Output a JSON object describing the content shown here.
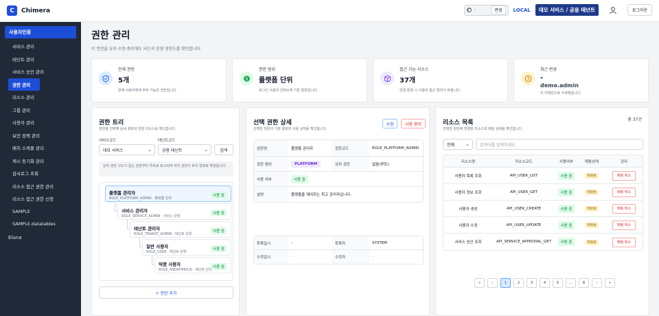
{
  "app": {
    "logo_letter": "C",
    "name": "Chimera"
  },
  "topbar": {
    "lang_value": "-",
    "lang_apply": "변경",
    "env": "LOCAL",
    "tenant": "데모 서비스 / 공용 테넌트",
    "logout": "로그아웃"
  },
  "sidebar": {
    "group": "사용자인증",
    "items": [
      "서비스 관리",
      "테넌트 관리",
      "서비스 승인 관리",
      "권한 관리",
      "리소스 관리",
      "그룹 관리",
      "사용자 관리",
      "보안 정책 관리",
      "배치 스케줄 관리",
      "캐시 동기화 관리",
      "감사로그 조회",
      "리소스 접근 권한 관리",
      "리소스 접근 권한 신청",
      "SAMPLE",
      "SAMPLE-datatables"
    ],
    "active_index": 3,
    "root": "Eluna"
  },
  "page": {
    "title": "권한 관리",
    "subtitle": "이 권한을 유지·수정·중지해도 되는지 운영 영향도를 확인합니다."
  },
  "stats": [
    {
      "label": "전체 권한",
      "value": "5개",
      "desc": "현재 사용자에게 부여 가능한 권한입니다.",
      "icon": "shield-icon",
      "color": "#2563eb",
      "bg": "#dbeafe"
    },
    {
      "label": "권한 범위",
      "value": "플랫폼 단위",
      "desc": "로그인 사용자 선택소에 기준 범위입니다.",
      "icon": "scope-icon",
      "color": "#16a34a",
      "bg": "#dcfce7"
    },
    {
      "label": "접근 가능 리소스",
      "value": "37개",
      "desc": "연결 변경 시 사용자 접근 범위가 바뀝니다.",
      "icon": "cube-icon",
      "color": "#7c3aed",
      "bg": "#ede9fe"
    },
    {
      "label": "최근 변경",
      "value": "-",
      "value2": "demo.admin",
      "desc": "이 이력만으로 수정했습니다.",
      "icon": "clock-icon",
      "color": "#d97706",
      "bg": "#fef3c7"
    }
  ],
  "tree": {
    "title": "권한 트리",
    "subtitle": "권한을 선택해 상세 정보와 연결 리소스를 확인합니다.",
    "service_label": "서비스코드",
    "tenant_label": "테넌트코드",
    "service_value": "데모 서비스",
    "tenant_value": "공용 테넌트",
    "search": "검색",
    "note": "상위 권한 코드가 없는 권한부터 루트로 표시되며 하위 권한이 트리 형태로 확장됩니다.",
    "add": "+ 권한 추가",
    "nodes": [
      {
        "name": "플랫폼 관리자",
        "code": "ROLE_PLATFORM_ADMIN · 플랫폼 단위",
        "status": "사용 중"
      },
      {
        "name": "서비스 관리자",
        "code": "ROLE_SERVICE_ADMIN · 서비스 단위",
        "status": "사용 중"
      },
      {
        "name": "테넌트 관리자",
        "code": "ROLE_TENANT_ADMIN · 테넌트 단위",
        "status": "사용 중"
      },
      {
        "name": "일반 사용자",
        "code": "ROLE_USER · 테넌트 단위",
        "status": "사용 중"
      },
      {
        "name": "익명 사용자",
        "code": "ROLE_ANONYMOUS · 테넌트 단위",
        "status": "사용 중"
      }
    ]
  },
  "detail": {
    "title": "선택 권한 상세",
    "subtitle": "선택한 권한의 기본 정보와 사용 상태를 확인합니다.",
    "edit": "수정",
    "stop": "사용 중지",
    "name_k": "권한명",
    "name_v": "플랫폼 관리자",
    "code_k": "권한코드",
    "code_v": "ROLE_PLATFORM_ADMIN",
    "scope_k": "권한 범위",
    "scope_v": "PLATFORM",
    "parent_k": "상위 권한",
    "parent_v": "없음(루트)",
    "use_k": "사용 여부",
    "use_v": "사용 중",
    "desc_k": "설명",
    "desc_v": "플랫폼을 제어하는 최고 관리자입니다.",
    "reg_k": "등록일시",
    "reg_v": "-",
    "reger_k": "등록자",
    "reger_v": "SYSTEM",
    "mod_k": "수정일시",
    "mod_v": "-",
    "moder_k": "수정자",
    "moder_v": "-"
  },
  "resources": {
    "title": "리소스 목록",
    "subtitle": "선택한 권한에 연결된 리소스와 매핑 상태를 확인합니다.",
    "total": "총 37건",
    "filter": "전체",
    "search_placeholder": "검색어를 입력하세요",
    "headers": [
      "리소스명",
      "리소스코드",
      "사용여부",
      "매핑상태",
      "관리"
    ],
    "rows": [
      {
        "name": "사용자 목록 조회",
        "code": "API_USER_LIST",
        "use": "사용 중",
        "map": "매핑됨",
        "action": "매핑 취소"
      },
      {
        "name": "사용자 정보 조회",
        "code": "API_USER_GET",
        "use": "사용 중",
        "map": "매핑됨",
        "action": "매핑 취소"
      },
      {
        "name": "사용자 생성",
        "code": "API_USER_CREATE",
        "use": "사용 중",
        "map": "매핑됨",
        "action": "매핑 취소"
      },
      {
        "name": "사용자 수정",
        "code": "API_USER_UPDATE",
        "use": "사용 중",
        "map": "매핑됨",
        "action": "매핑 취소"
      },
      {
        "name": "서비스 승인 조회",
        "code": "API_SERVICE_APPROVAL_GET",
        "use": "사용 중",
        "map": "매핑됨",
        "action": "매핑 취소"
      }
    ],
    "pager": [
      "«",
      "‹",
      "1",
      "2",
      "3",
      "4",
      "5",
      "...",
      "8",
      "›",
      "»"
    ]
  }
}
